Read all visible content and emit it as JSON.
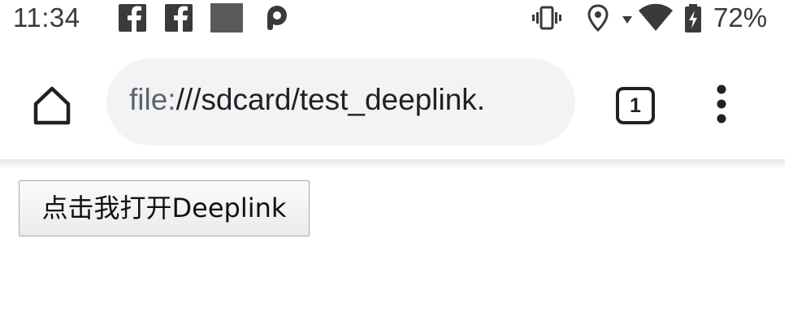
{
  "status_bar": {
    "time": "11:34",
    "notification_icons": [
      "facebook-icon",
      "facebook-icon",
      "gray-square-icon",
      "pinterest-p-icon"
    ],
    "system_icons": [
      "vibrate-icon",
      "location-icon",
      "signal-arrow-icon",
      "wifi-icon",
      "battery-charging-icon"
    ],
    "battery_percent": "72%"
  },
  "toolbar": {
    "url_scheme": "file:",
    "url_rest": "///sdcard/test_deeplink.",
    "tab_count": "1"
  },
  "page": {
    "button_label": "点击我打开Deeplink"
  },
  "colors": {
    "status_text": "#3a3a3a",
    "url_pill_bg": "#f1f3f4",
    "icon_dark": "#202124",
    "button_border": "#a9a9a9"
  }
}
